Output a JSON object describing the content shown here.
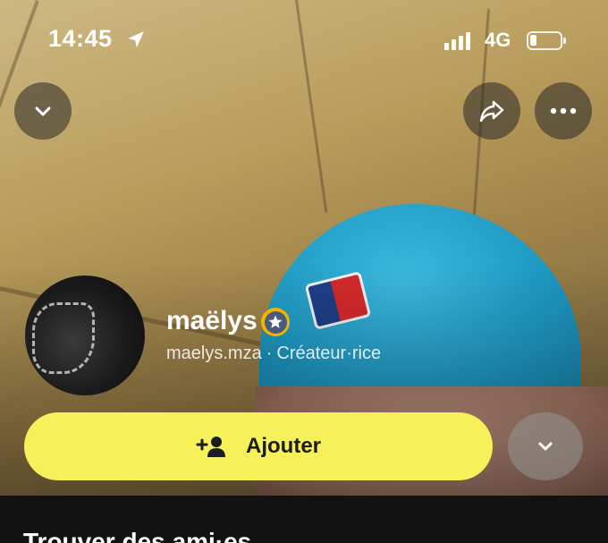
{
  "status_bar": {
    "time": "14:45",
    "network": "4G",
    "icons": [
      "location-arrow-icon",
      "signal-icon",
      "battery-icon"
    ]
  },
  "top_actions": {
    "collapse_icon": "chevron-down-icon",
    "share_icon": "share-arrow-icon",
    "more_icon": "ellipsis-icon"
  },
  "profile": {
    "display_name": "maëlys",
    "username": "maelys.mza",
    "separator": "·",
    "role": "Créateur·rice",
    "badge_icon": "star-badge-icon"
  },
  "actions": {
    "add_label": "Ajouter",
    "add_icon": "add-friend-icon",
    "expand_icon": "chevron-down-icon"
  },
  "section": {
    "title": "Trouver des ami·es"
  },
  "colors": {
    "add_button": "#f6f05a",
    "badge_ring": "#f1b400",
    "background": "#121212"
  }
}
